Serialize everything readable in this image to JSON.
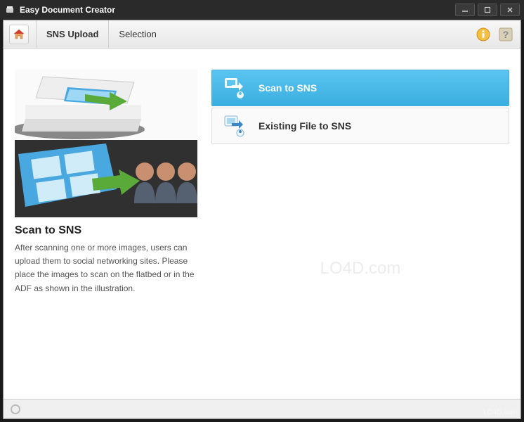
{
  "window": {
    "title": "Easy Document Creator"
  },
  "toolbar": {
    "breadcrumb1": "SNS Upload",
    "breadcrumb2": "Selection"
  },
  "leftPanel": {
    "title": "Scan to SNS",
    "description": "After scanning one or more images, users can upload them to social networking sites. Please place the images to scan on the flatbed or in the ADF as shown in the illustration."
  },
  "options": [
    {
      "label": "Scan to SNS",
      "selected": true
    },
    {
      "label": "Existing File to SNS",
      "selected": false
    }
  ],
  "watermark": "LO4D.com"
}
